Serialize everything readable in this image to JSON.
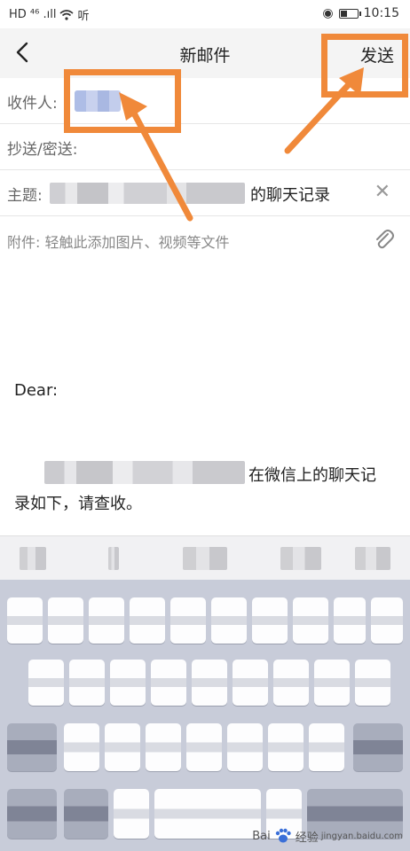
{
  "status_bar": {
    "carrier_left": "HD ⁴⁶ .ıll",
    "signal_text": "听",
    "time": "10:15"
  },
  "header": {
    "title": "新邮件",
    "send_label": "发送"
  },
  "fields": {
    "to_label": "收件人:",
    "cc_label": "抄送/密送:",
    "subject_label": "主题:",
    "subject_suffix": "的聊天记录",
    "attach_placeholder": "附件: 轻触此添加图片、视频等文件"
  },
  "body": {
    "greeting": "Dear:",
    "line1_suffix": "在微信上的聊天记",
    "line2": "录如下，请查收。"
  },
  "watermark": {
    "brand": "Bai",
    "brand_cn": "经验",
    "url": "jingyan.baidu.com"
  },
  "colors": {
    "annotation": "#f0893a",
    "keyboard_bg": "#c8ccd9"
  },
  "icons": {
    "back": "chevron-left-icon",
    "clear": "close-icon",
    "attach": "paperclip-icon",
    "visibility": "eye-icon",
    "battery": "battery-icon",
    "wifi": "wifi-icon"
  }
}
